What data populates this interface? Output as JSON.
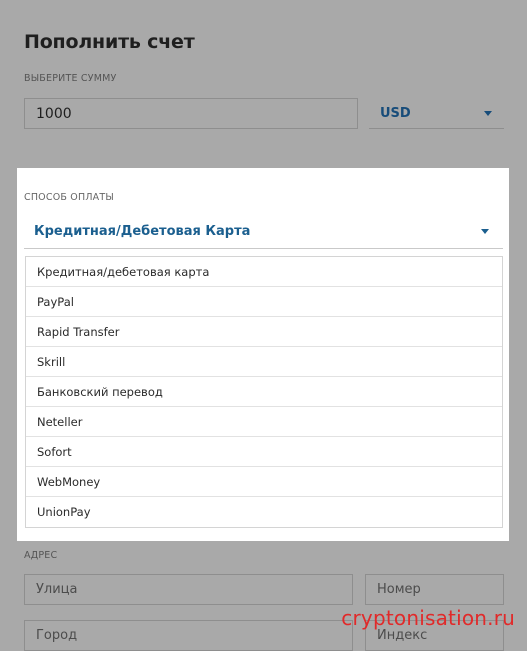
{
  "page": {
    "title": "Пополнить счет"
  },
  "amount": {
    "label": "ВЫБЕРИТЕ СУММУ",
    "value": "1000"
  },
  "currency": {
    "selected": "USD"
  },
  "payment": {
    "label": "СПОСОБ ОПЛАТЫ",
    "selected": "Кредитная/Дебетовая Карта",
    "options": [
      "Кредитная/дебетовая карта",
      "PayPal",
      "Rapid Transfer",
      "Skrill",
      "Банковский перевод",
      "Neteller",
      "Sofort",
      "WebMoney",
      "UnionPay"
    ]
  },
  "address": {
    "label": "АДРЕС",
    "street_placeholder": "Улица",
    "number_placeholder": "Номер",
    "city_placeholder": "Город",
    "zip_placeholder": "Индекс"
  },
  "watermark": "cryptonisation.ru",
  "colors": {
    "accent": "#1b5f8f",
    "overlay": "#a9a9a9",
    "watermark": "#e12a2a"
  }
}
